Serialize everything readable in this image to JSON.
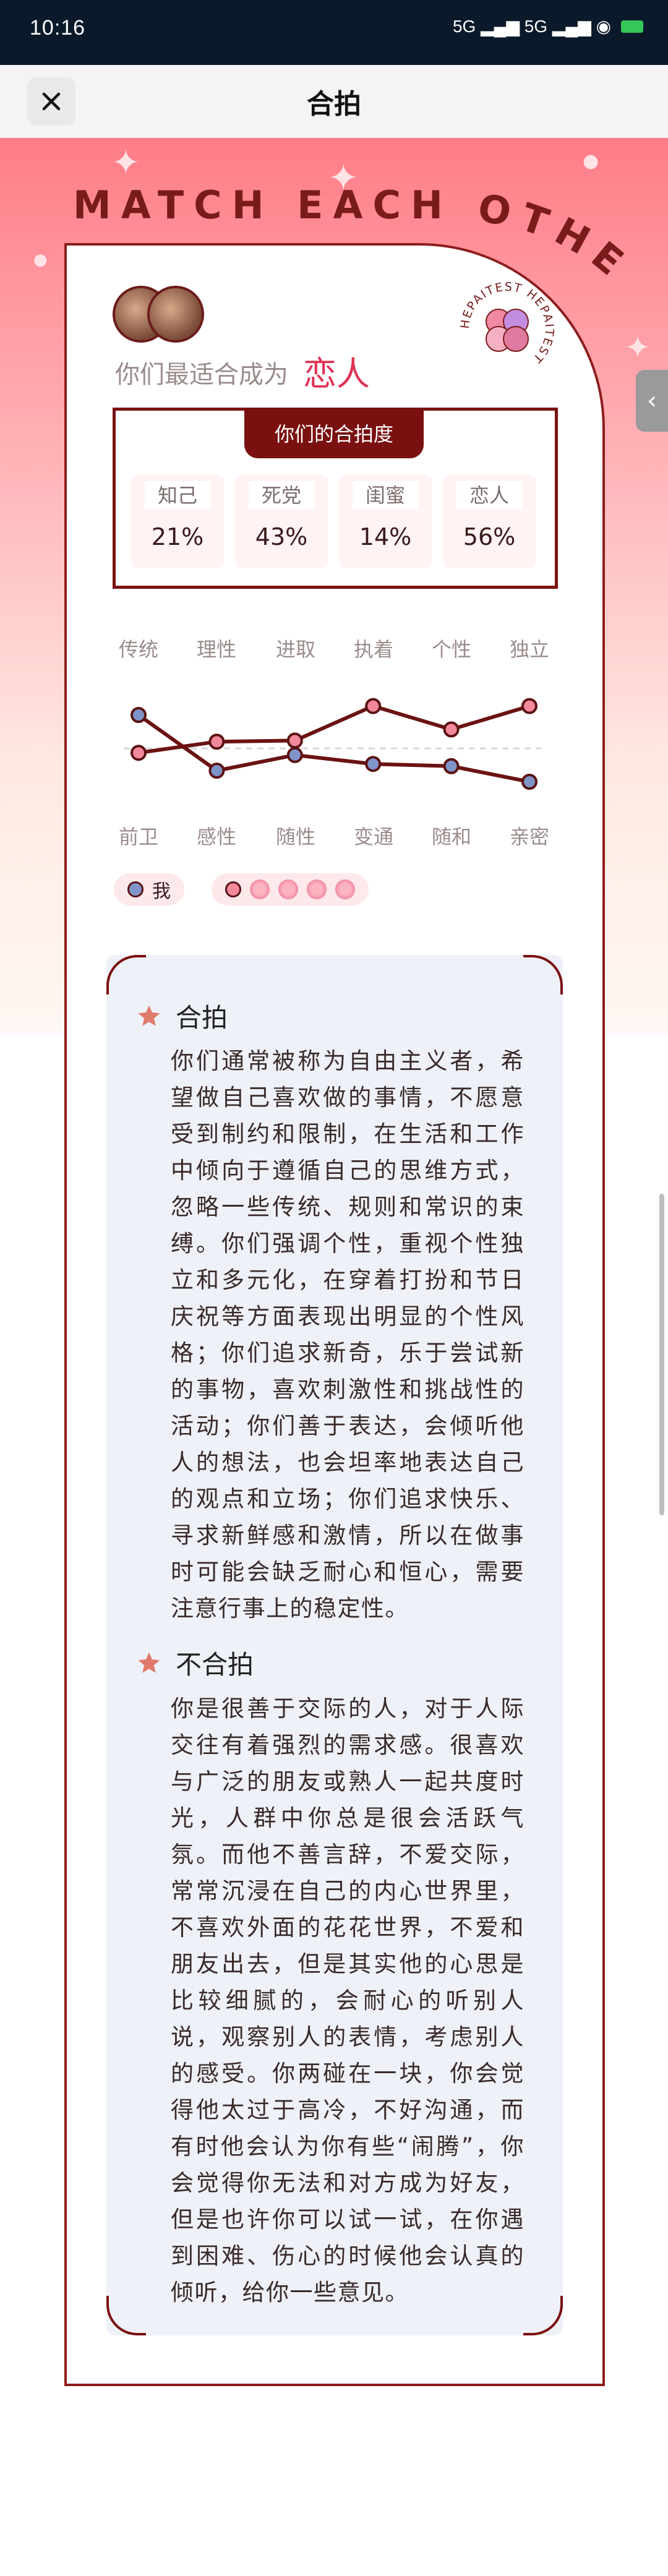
{
  "status_bar": {
    "time": "10:16",
    "right_text": "5G ▂▄▆ 5G ▂▄▆ ◉"
  },
  "header": {
    "title": "合拍",
    "close_icon": "close-icon"
  },
  "hero": {
    "arc_title": "MATCH EACH OTHER"
  },
  "match": {
    "prefix": "你们最适合成为",
    "result": "恋人"
  },
  "logo": {
    "ring_text": "HEPAITEST HEPAITEST"
  },
  "degree": {
    "tab_label": "你们的合拍度",
    "items": [
      {
        "label": "知己",
        "value": "21%"
      },
      {
        "label": "死党",
        "value": "43%"
      },
      {
        "label": "闺蜜",
        "value": "14%"
      },
      {
        "label": "恋人",
        "value": "56%"
      }
    ]
  },
  "traits_top": [
    "传统",
    "理性",
    "进取",
    "执着",
    "个性",
    "独立"
  ],
  "traits_bottom": [
    "前卫",
    "感性",
    "随性",
    "变通",
    "随和",
    "亲密"
  ],
  "chart_data": {
    "type": "line",
    "categories": [
      "传统/前卫",
      "理性/感性",
      "进取/随性",
      "执着/变通",
      "个性/随和",
      "独立/亲密"
    ],
    "ylim": [
      0,
      100
    ],
    "series": [
      {
        "name": "我",
        "color": "#7f94c8",
        "values": [
          80,
          30,
          44,
          36,
          34,
          20
        ]
      },
      {
        "name": "",
        "color": "#f1889c",
        "values": [
          46,
          56,
          57,
          88,
          67,
          88
        ]
      }
    ]
  },
  "legend": {
    "me_label": "我",
    "partner_icons": 4
  },
  "sections": [
    {
      "title": "合拍",
      "body": "你们通常被称为自由主义者，希望做自己喜欢做的事情，不愿意受到制约和限制，在生活和工作中倾向于遵循自己的思维方式，忽略一些传统、规则和常识的束缚。你们强调个性，重视个性独立和多元化，在穿着打扮和节日庆祝等方面表现出明显的个性风格；你们追求新奇，乐于尝试新的事物，喜欢刺激性和挑战性的活动；你们善于表达，会倾听他人的想法，也会坦率地表达自己的观点和立场；你们追求快乐、寻求新鲜感和激情，所以在做事时可能会缺乏耐心和恒心，需要注意行事上的稳定性。"
    },
    {
      "title": "不合拍",
      "body": "你是很善于交际的人，对于人际交往有着强烈的需求感。很喜欢与广泛的朋友或熟人一起共度时光，人群中你总是很会活跃气氛。而他不善言辞，不爱交际，常常沉浸在自己的内心世界里，不喜欢外面的花花世界，不爱和朋友出去，但是其实他的心思是比较细腻的，会耐心的听别人说，观察别人的表情，考虑别人的感受。你两碰在一块，你会觉得他太过于高冷，不好沟通，而有时他会认为你有些“闹腾”，你会觉得你无法和对方成为好友，但是也许你可以试一试，在你遇到困难、伤心的时候他会认真的倾听，给你一些意见。"
    }
  ],
  "colors": {
    "accent": "#7a1010",
    "highlight": "#e03155",
    "me": "#7f94c8",
    "partner": "#f1889c"
  }
}
